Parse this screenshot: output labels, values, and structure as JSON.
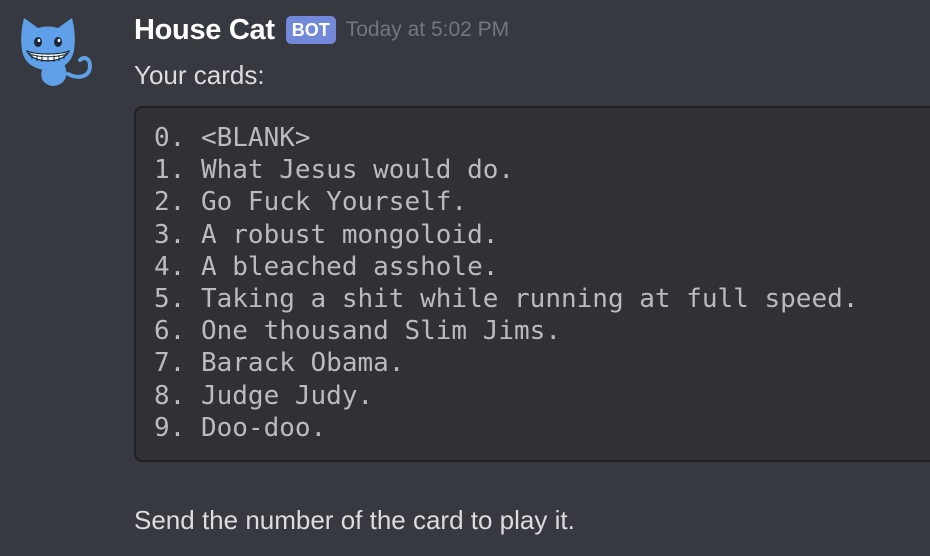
{
  "message": {
    "author": "House Cat",
    "bot_tag": "BOT",
    "timestamp": "Today at 5:02 PM",
    "intro": "Your cards:",
    "cards": [
      "0. <BLANK>",
      "1. What Jesus would do.",
      "2. Go Fuck Yourself.",
      "3. A robust mongoloid.",
      "4. A bleached asshole.",
      "5. Taking a shit while running at full speed.",
      "6. One thousand Slim Jims.",
      "7. Barack Obama.",
      "8. Judge Judy.",
      "9. Doo-doo."
    ],
    "outro": "Send the number of the card to play it."
  },
  "colors": {
    "background": "#36393f",
    "codeblock_background": "#2f3136",
    "bot_tag": "#7289da",
    "avatar_cat": "#5fa0e8"
  },
  "avatar": {
    "icon": "grinning-cat-icon"
  }
}
